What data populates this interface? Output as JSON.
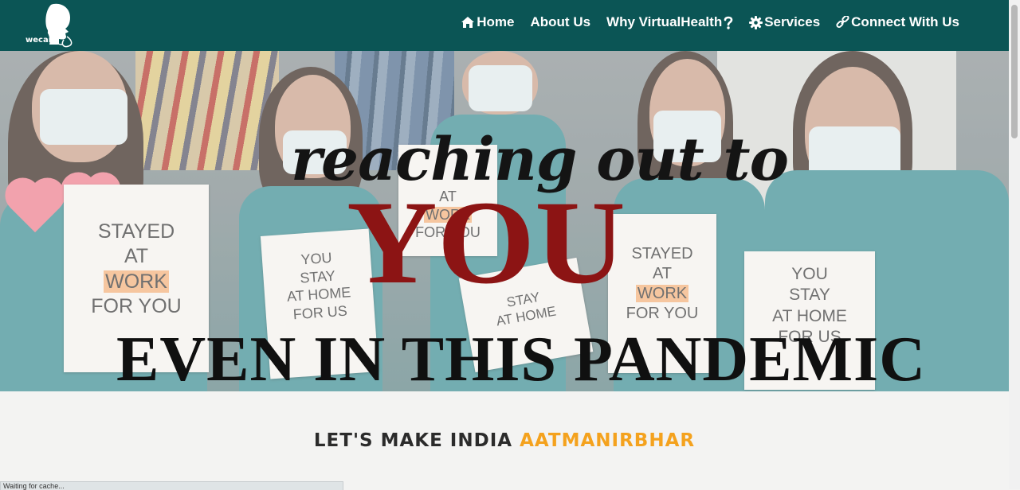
{
  "brand": {
    "name": "wecare"
  },
  "nav": {
    "items": [
      {
        "label": "Home",
        "icon": "home-icon"
      },
      {
        "label": "About Us"
      },
      {
        "label": "Why VirtualHealth",
        "icon": "question-icon"
      },
      {
        "label": "Services",
        "icon": "gear-icon"
      },
      {
        "label": "Connect With Us",
        "icon": "link-icon"
      }
    ]
  },
  "hero": {
    "line1": "reaching out to",
    "line2": "YOU",
    "line3": "EVEN IN THIS PANDEMIC",
    "signs": {
      "sign1": [
        "STAYED",
        "AT",
        "WORK",
        "FOR YOU"
      ],
      "sign2": [
        "YOU",
        "STAY",
        "AT HOME",
        "FOR US"
      ],
      "sign3": [
        "AT",
        "WORK",
        "FOR YOU"
      ],
      "sign4": [
        "STAY",
        "AT HOME"
      ],
      "sign5": [
        "STAYED",
        "AT",
        "WORK",
        "FOR YOU"
      ],
      "sign6": [
        "YOU",
        "STAY",
        "AT HOME",
        "FOR US"
      ]
    }
  },
  "section": {
    "title_prefix": "LET'S MAKE INDIA ",
    "title_accent": "AATMANIRBHAR"
  },
  "status": {
    "text": "Waiting for cache..."
  },
  "colors": {
    "navbar": "#0b5555",
    "accent": "#f4a21e",
    "you": "#8c1414",
    "page_bg": "#f3f3f2"
  }
}
